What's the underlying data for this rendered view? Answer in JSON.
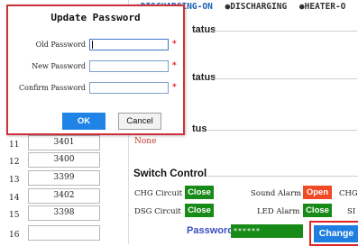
{
  "status_strip": {
    "items": [
      {
        "label": "●DISCHARGING-ON"
      },
      {
        "label": "●DISCHARGING"
      },
      {
        "label": "●HEATER-O"
      }
    ],
    "colors": {
      "active": "#1a5fb4",
      "inactive": "#333333"
    }
  },
  "panels": {
    "status_1": "tatus",
    "status_2": "tatus",
    "status_3": "tus",
    "status_3_value": "None"
  },
  "cells": [
    {
      "index": "11",
      "value": "3401"
    },
    {
      "index": "12",
      "value": "3400"
    },
    {
      "index": "13",
      "value": "3399"
    },
    {
      "index": "14",
      "value": "3402"
    },
    {
      "index": "15",
      "value": "3398"
    },
    {
      "index": "16",
      "value": ""
    }
  ],
  "switch_control": {
    "title": "Switch Control",
    "chg_circuit": {
      "label": "CHG Circuit",
      "button": "Close",
      "color": "#178a17"
    },
    "sound_alarm": {
      "label": "Sound Alarm",
      "button": "Open",
      "color": "#ef4a23"
    },
    "chg_extra_label": "CHG I",
    "dsg_circuit": {
      "label": "DSG Circuit",
      "button": "Close",
      "color": "#178a17"
    },
    "led_alarm": {
      "label": "LED Alarm",
      "button": "Close",
      "color": "#178a17"
    },
    "dsg_extra_label": "SI"
  },
  "password_bar": {
    "label": "Password",
    "value": "******",
    "change_button": "Change"
  },
  "dialog": {
    "title": "Update Password",
    "old_password_label": "Old Password",
    "new_password_label": "New Password",
    "confirm_password_label": "Confirm Password",
    "old_password_value": "",
    "new_password_value": "",
    "confirm_password_value": "",
    "required_marker": "*",
    "ok_label": "OK",
    "cancel_label": "Cancel",
    "colors": {
      "border": "#d0303a",
      "ok": "#1f84e6",
      "required": "#e02424"
    }
  }
}
